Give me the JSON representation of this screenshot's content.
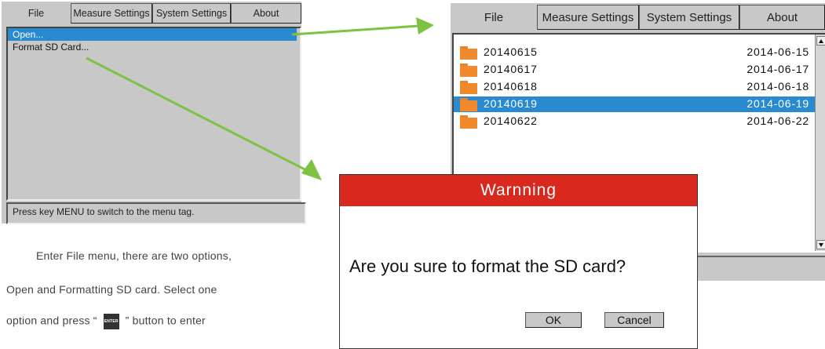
{
  "left_screen": {
    "menu_tabs": [
      "File",
      "Measure Settings",
      "System Settings",
      "About"
    ],
    "menu_items": [
      {
        "label": "Open...",
        "selected": true
      },
      {
        "label": "Format SD Card...",
        "selected": false
      }
    ],
    "status_text": "Press key MENU to switch to the menu tag."
  },
  "description": {
    "line1": "Enter File menu, there are two options,",
    "line2": "Open and Formatting SD card. Select one",
    "line3_before": "option and press “",
    "enter_key_label": "ENTER",
    "line3_after": "” button to enter"
  },
  "right_screen": {
    "menu_tabs": [
      "File",
      "Measure Settings",
      "System Settings",
      "About"
    ],
    "files": [
      {
        "name": "20140615",
        "date": "2014-06-15",
        "selected": false
      },
      {
        "name": "20140617",
        "date": "2014-06-17",
        "selected": false
      },
      {
        "name": "20140618",
        "date": "2014-06-18",
        "selected": false
      },
      {
        "name": "20140619",
        "date": "2014-06-19",
        "selected": true
      },
      {
        "name": "20140622",
        "date": "2014-06-22",
        "selected": false
      }
    ]
  },
  "dialog": {
    "title": "Warnning",
    "message": "Are you sure to format the SD card?",
    "ok_label": "OK",
    "cancel_label": "Cancel"
  },
  "colors": {
    "selection": "#2a8ad0",
    "dialog_title_bg": "#d9281e",
    "arrow": "#7dc242",
    "folder": "#f08a2c",
    "screen_bg": "#c8c8c8"
  },
  "icons": [
    "folder-icon",
    "scroll-up-icon",
    "scroll-down-icon",
    "enter-key-icon",
    "arrow-icon"
  ]
}
